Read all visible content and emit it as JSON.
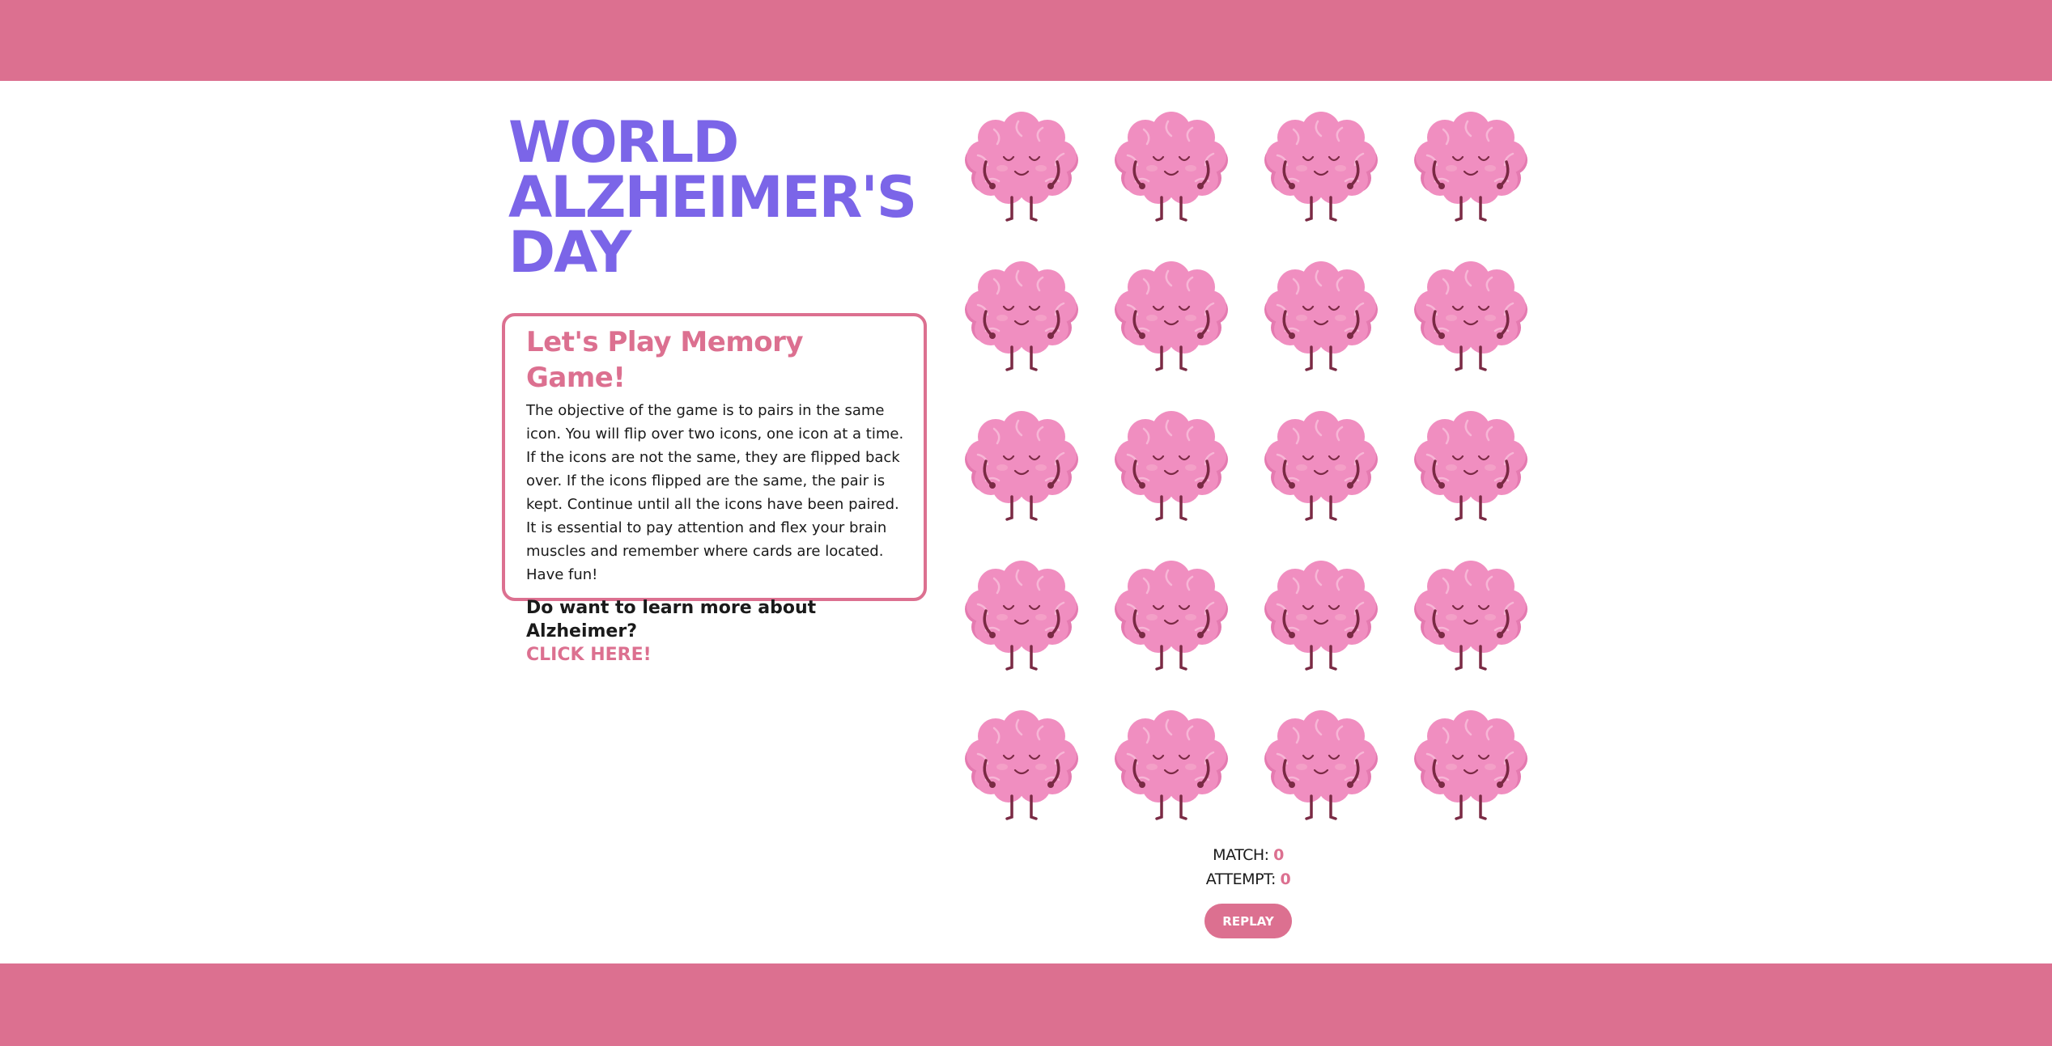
{
  "header": {
    "title_lines": [
      "WORLD",
      "ALZHEIMER'S",
      "DAY"
    ]
  },
  "info": {
    "heading": "Let's Play Memory Game!",
    "description": "The objective of the game is to pairs in the same icon. You will flip over two icons, one icon at a time. If the icons are not the same, they are flipped back over. If the icons flipped are the same, the pair is kept. Continue until all the icons have been paired. It is essential to pay attention and flex your brain muscles and remember where cards are located. Have fun!",
    "learn_more_question": "Do want to learn more about Alzheimer?",
    "learn_more_link": "CLICK HERE!"
  },
  "board": {
    "columns": 4,
    "rows": 5,
    "card_back_icon": "cartoon-brain-icon",
    "card_count": 20
  },
  "stats": {
    "match_label": "MATCH:",
    "match_value": "0",
    "attempt_label": "ATTEMPT:",
    "attempt_value": "0"
  },
  "controls": {
    "replay_label": "REPLAY"
  },
  "colors": {
    "band": "#dc7090",
    "title": "#7b65e8",
    "accent": "#dc7090",
    "brain": "#f08ec0",
    "brain_dark": "#e47ab0",
    "limbs": "#7a2a44"
  }
}
